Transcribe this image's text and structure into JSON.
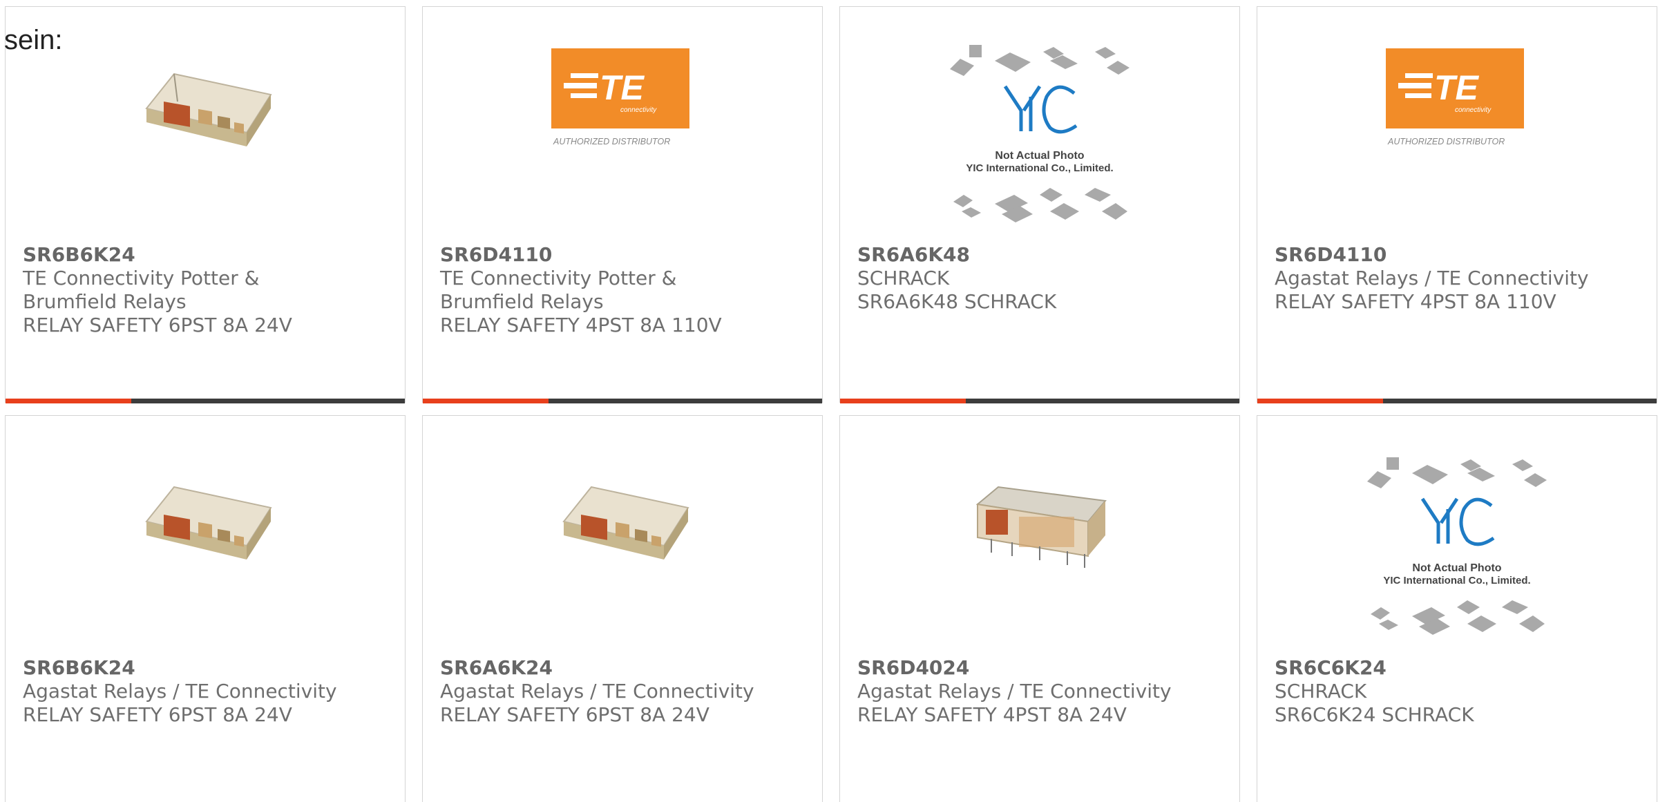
{
  "intro_text": "sein:",
  "colors": {
    "accent_bar": "#e8401c",
    "bar": "#3d3d3d",
    "te_orange": "#f28c28"
  },
  "products": [
    {
      "part": "SR6B6K24",
      "manufacturer_line1": "TE Connectivity Potter &",
      "manufacturer_line2": "Brumfield Relays",
      "description": "RELAY SAFETY 6PST 8A 24V",
      "image": "relay-photo-icon"
    },
    {
      "part": "SR6D4110",
      "manufacturer_line1": "TE Connectivity Potter &",
      "manufacturer_line2": "Brumfield Relays",
      "description": "RELAY SAFETY 4PST 8A 110V",
      "image": "te-connectivity-logo",
      "logo_text": "TE",
      "logo_subtext": "connectivity",
      "logo_caption": "AUTHORIZED DISTRIBUTOR"
    },
    {
      "part": "SR6A6K48",
      "manufacturer_line1": "SCHRACK",
      "manufacturer_line2": "",
      "description": "SR6A6K48 SCHRACK",
      "image": "yic-placeholder",
      "placeholder_line1": "Not Actual Photo",
      "placeholder_line2": "YIC International Co., Limited."
    },
    {
      "part": "SR6D4110",
      "manufacturer_line1": "Agastat Relays / TE Connectivity",
      "manufacturer_line2": "",
      "description": "RELAY SAFETY 4PST 8A 110V",
      "image": "te-connectivity-logo",
      "logo_text": "TE",
      "logo_subtext": "connectivity",
      "logo_caption": "AUTHORIZED DISTRIBUTOR"
    },
    {
      "part": "SR6B6K24",
      "manufacturer_line1": "Agastat Relays / TE Connectivity",
      "manufacturer_line2": "",
      "description": "RELAY SAFETY 6PST 8A 24V",
      "image": "relay-photo-icon"
    },
    {
      "part": "SR6A6K24",
      "manufacturer_line1": "Agastat Relays / TE Connectivity",
      "manufacturer_line2": "",
      "description": "RELAY SAFETY 6PST 8A 24V",
      "image": "relay-photo-icon"
    },
    {
      "part": "SR6D4024",
      "manufacturer_line1": "Agastat Relays / TE Connectivity",
      "manufacturer_line2": "",
      "description": "RELAY SAFETY 4PST 8A 24V",
      "image": "relay-side-photo-icon"
    },
    {
      "part": "SR6C6K24",
      "manufacturer_line1": "SCHRACK",
      "manufacturer_line2": "",
      "description": "SR6C6K24 SCHRACK",
      "image": "yic-placeholder",
      "placeholder_line1": "Not Actual Photo",
      "placeholder_line2": "YIC International Co., Limited."
    }
  ]
}
